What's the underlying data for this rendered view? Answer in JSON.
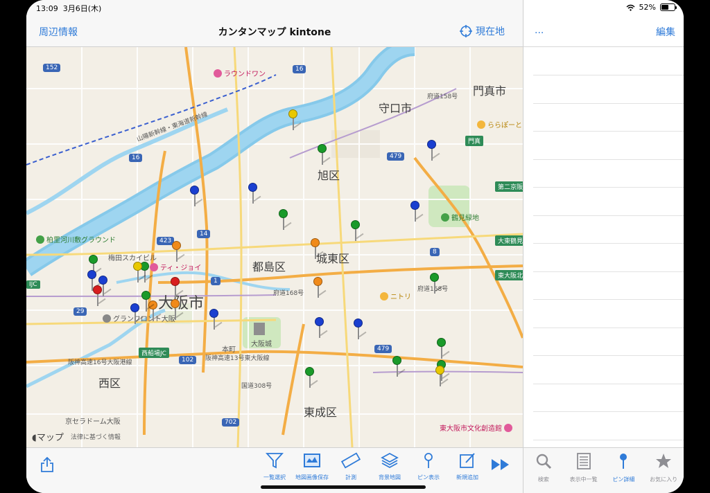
{
  "status": {
    "time": "13:09",
    "date": "3月6日(木)",
    "battery": "52%",
    "battery_level": 0.52
  },
  "navbar": {
    "left": "周辺情報",
    "title": "カンタンマップ kintone",
    "location": "現在地"
  },
  "sidebar": {
    "more": "...",
    "edit": "編集",
    "rows": 14
  },
  "map": {
    "places": {
      "kadoma": "門真市",
      "moriguchi": "守口市",
      "asahi": "旭区",
      "miyakojima": "都島区",
      "joto": "城東区",
      "osaka": "大阪市",
      "nishi": "西区",
      "higashinari": "東成区"
    },
    "pois": {
      "roundone": "ラウンドワン",
      "lalaport": "ららぽーと",
      "tsurumi": "鶴見緑地",
      "kashiwazato": "柏里河川敷グラウンド",
      "umeda": "梅田スカイビル",
      "tijoy": "ティ・ジョイ",
      "grandfront": "グランフロント大阪",
      "osakajo": "大阪城",
      "nitori": "ニトリ",
      "higashiosaka": "東大阪市文化創造館",
      "kyocera": "京セラドーム大阪",
      "honmachi": "本町"
    },
    "signs": {
      "kadoma_sign": "門真",
      "nikyo": "第二京阪道",
      "daito": "大東鶴見",
      "higashiosakakita": "東大阪北",
      "nishifunaba": "西船場JC",
      "ijc": "IJC"
    },
    "routes": [
      "152",
      "16",
      "16",
      "479",
      "8",
      "423",
      "14",
      "1",
      "29",
      "102",
      "702",
      "479"
    ],
    "road_labels": {
      "fudo158": "府道158号",
      "fudo168": "府道168号",
      "fudo168b": "府道168号",
      "kokudo308": "国道308号",
      "hanshin16": "阪神高速16号大阪港線",
      "hanshin13": "阪神高速13号東大阪線",
      "sanyo": "山陽新幹線・東海道新幹線",
      "kokudo1": "国道1号"
    },
    "legal": {
      "brand": "マップ",
      "notice": "法律に基づく情報"
    },
    "pins": [
      {
        "color": "#e8c800"
      },
      {
        "color": "#1a9a2a"
      },
      {
        "color": "#1a3fd0"
      },
      {
        "color": "#1a3fd0"
      },
      {
        "color": "#1a3fd0"
      },
      {
        "color": "#1a9a2a"
      },
      {
        "color": "#1a9a2a"
      },
      {
        "color": "#1a3fd0"
      },
      {
        "color": "#f08a1a"
      },
      {
        "color": "#f08a1a"
      },
      {
        "color": "#1a9a2a"
      },
      {
        "color": "#1a9a2a"
      },
      {
        "color": "#e8c800"
      },
      {
        "color": "#1a3fd0"
      },
      {
        "color": "#1a3fd0"
      },
      {
        "color": "#d81e1e"
      },
      {
        "color": "#d81e1e"
      },
      {
        "color": "#f08a1a"
      },
      {
        "color": "#f08a1a"
      },
      {
        "color": "#1a9a2a"
      },
      {
        "color": "#1a3fd0"
      },
      {
        "color": "#1a3fd0"
      },
      {
        "color": "#1a3fd0"
      },
      {
        "color": "#f08a1a"
      },
      {
        "color": "#1a3fd0"
      },
      {
        "color": "#1a9a2a"
      },
      {
        "color": "#1a9a2a"
      },
      {
        "color": "#1a9a2a"
      },
      {
        "color": "#1a9a2a"
      },
      {
        "color": "#e8c800"
      },
      {
        "color": "#1a9a2a"
      }
    ]
  },
  "toolbar": {
    "items": [
      {
        "label": "一覧選択",
        "icon": "funnel-icon"
      },
      {
        "label": "地図画像保存",
        "icon": "map-save-icon"
      },
      {
        "label": "計測",
        "icon": "ruler-icon"
      },
      {
        "label": "背景地図",
        "icon": "layers-icon"
      },
      {
        "label": "ピン表示",
        "icon": "pin-icon"
      },
      {
        "label": "新規追加",
        "icon": "compose-icon"
      }
    ]
  },
  "sidetabs": [
    {
      "label": "検索",
      "icon": "search-icon",
      "active": false
    },
    {
      "label": "表示中一覧",
      "icon": "list-icon",
      "active": false
    },
    {
      "label": "ピン詳細",
      "icon": "pin-icon",
      "active": true
    },
    {
      "label": "お気に入り",
      "icon": "star-icon",
      "active": false
    }
  ],
  "colors": {
    "accent": "#2f7bd8",
    "river": "#7fc8e8",
    "highway": "#f0a030",
    "park": "#cfe8bf"
  }
}
